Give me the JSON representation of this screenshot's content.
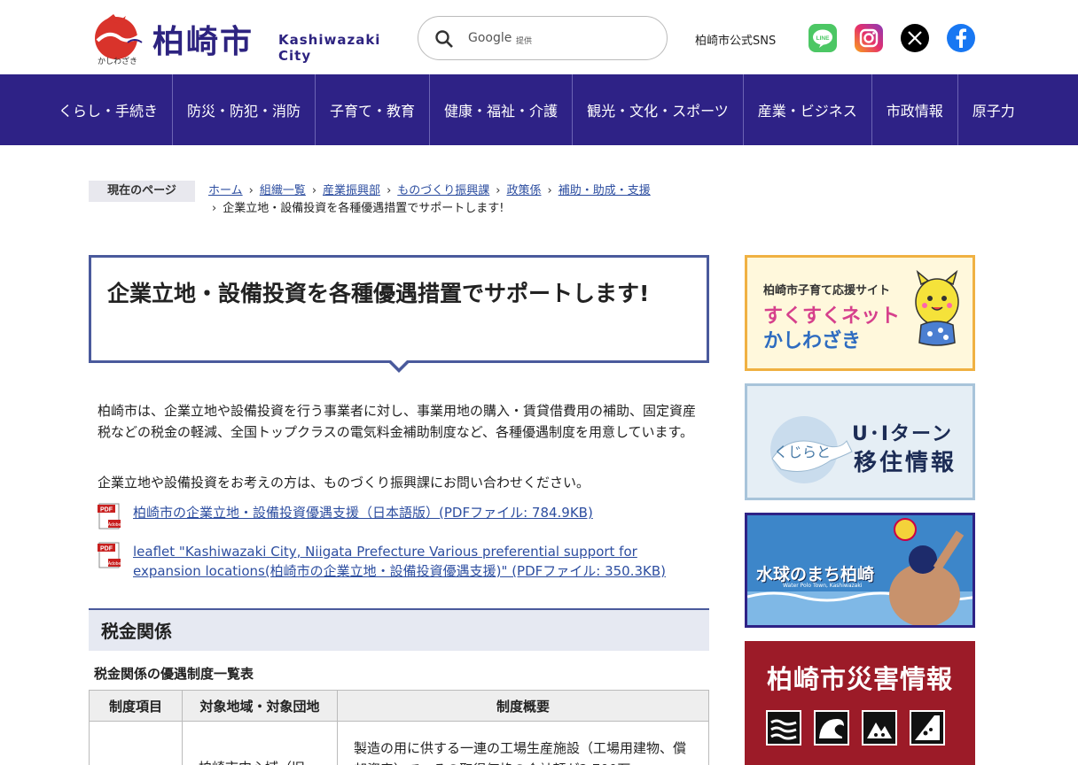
{
  "header": {
    "logo_kanji": "柏崎市",
    "logo_en": "Kashiwazaki City",
    "logo_sub": "かしわざき",
    "search_google": "Google",
    "search_provided": "提供",
    "sns_label": "柏崎市公式SNS"
  },
  "nav": {
    "items": [
      {
        "label": "くらし・手続き"
      },
      {
        "label": "防災・防犯・消防"
      },
      {
        "label": "子育て・教育"
      },
      {
        "label": "健康・福祉・介護"
      },
      {
        "label": "観光・文化・スポーツ"
      },
      {
        "label": "産業・ビジネス"
      },
      {
        "label": "市政情報"
      },
      {
        "label": "原子力"
      }
    ]
  },
  "breadcrumb": {
    "label": "現在のページ",
    "links": [
      "ホーム",
      "組織一覧",
      "産業振興部",
      "ものづくり振興課",
      "政策係",
      "補助・助成・支援"
    ],
    "current": "企業立地・設備投資を各種優遇措置でサポートします!"
  },
  "main": {
    "title": "企業立地・設備投資を各種優遇措置でサポートします!",
    "para1": "柏崎市は、企業立地や設備投資を行う事業者に対し、事業用地の購入・賃貸借費用の補助、固定資産税などの税金の軽減、全国トップクラスの電気料金補助制度など、各種優遇制度を用意しています。",
    "para2": "企業立地や設備投資をお考えの方は、ものづくり振興課にお問い合わせください。",
    "link1": "柏崎市の企業立地・設備投資優遇支援（日本語版）(PDFファイル: 784.9KB)",
    "link2": "leaflet \"Kashiwazaki City, Niigata Prefecture Various preferential support for expansion locations(柏崎市の企業立地・設備投資優遇支援)\" (PDFファイル: 350.3KB)",
    "section_title": "税金関係",
    "sub_title": "税金関係の優遇制度一覧表",
    "table": {
      "headers": [
        "制度項目",
        "対象地域・対象団地",
        "制度概要"
      ],
      "row1": [
        "",
        "柏崎市中心域（旧",
        "製造の用に供する一連の工場生産施設（工場用建物、償却資産）で、その取得価格の合計額が2,700万"
      ]
    }
  },
  "sidebar": {
    "b1_small": "柏崎市子育て応援サイト",
    "b1_main1": "すくすくネット",
    "b1_main2": "かしわざき",
    "b2_t1": "U･Iターン",
    "b2_t2": "移住情報",
    "b2_logo_text": "くじらと",
    "b3_title": "水球のまち柏崎",
    "b3_sub": "Water Polo Town, Kashiwazaki",
    "b4_title": "柏崎市災害情報"
  },
  "colors": {
    "brand": "#2e2286",
    "link": "#2d4ea0",
    "title_border": "#4a5a9c",
    "disaster": "#9c1b28"
  }
}
